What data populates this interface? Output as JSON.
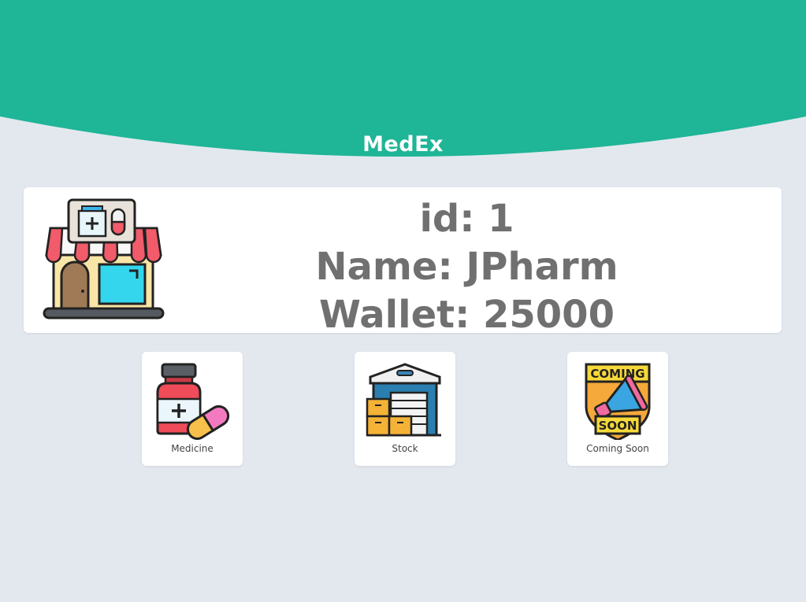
{
  "app": {
    "title": "MedEx",
    "header_color": "#1fb597",
    "background_color": "#e3e8ef"
  },
  "profile": {
    "icon": "pharmacy-store-icon",
    "id_text": "id: 1",
    "name_text": "Name: JPharm",
    "wallet_text": "Wallet: 25000"
  },
  "tiles": [
    {
      "label": "Medicine",
      "icon": "medicine-bottle-icon"
    },
    {
      "label": "Stock",
      "icon": "warehouse-icon"
    },
    {
      "label": "Coming Soon",
      "icon": "coming-soon-megaphone-icon"
    }
  ]
}
